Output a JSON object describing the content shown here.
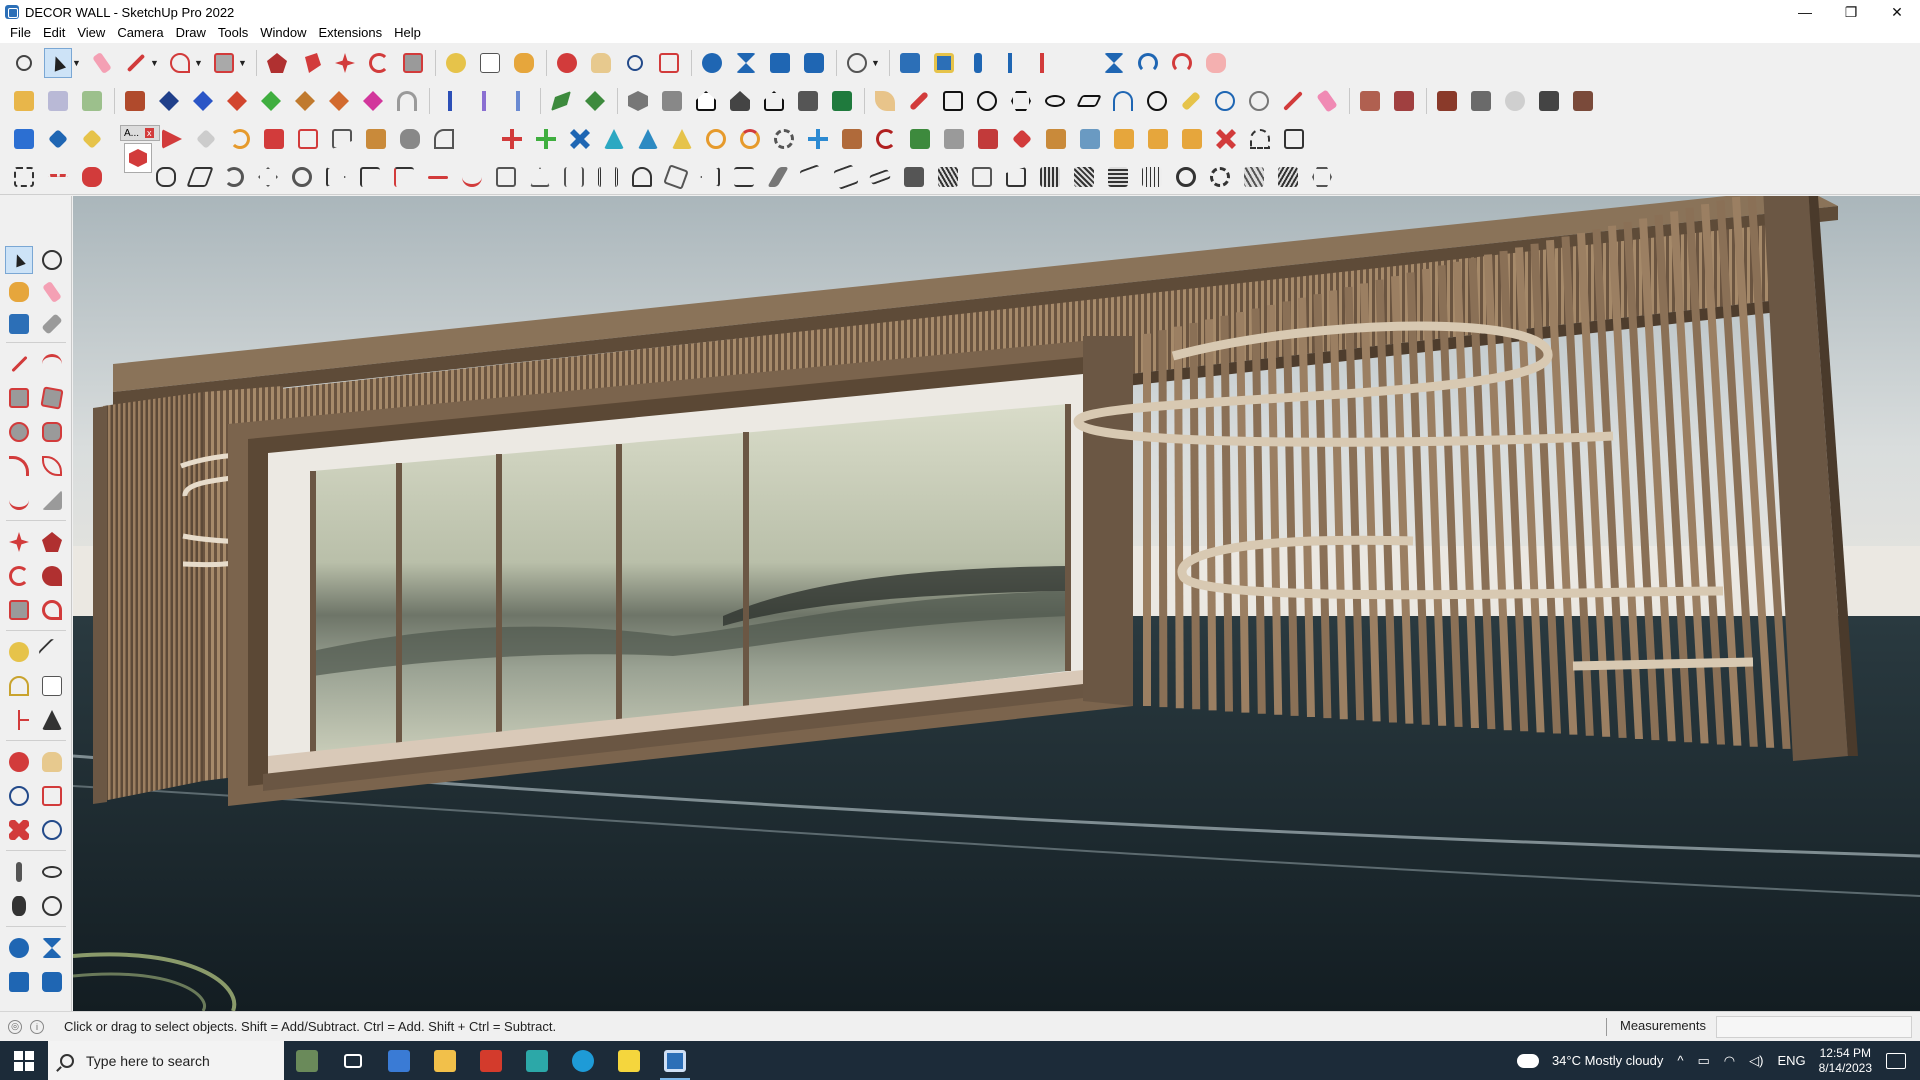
{
  "window": {
    "title": "DECOR WALL - SketchUp Pro 2022",
    "controls": [
      "—",
      "❐",
      "✕"
    ]
  },
  "menu": [
    "File",
    "Edit",
    "View",
    "Camera",
    "Draw",
    "Tools",
    "Window",
    "Extensions",
    "Help"
  ],
  "floating_tab": {
    "label": "A...",
    "close": "x"
  },
  "status": {
    "hint": "Click or drag to select objects. Shift = Add/Subtract. Ctrl = Add. Shift + Ctrl = Subtract.",
    "measurements_label": "Measurements",
    "measurements_value": ""
  },
  "taskbar": {
    "search_placeholder": "Type here to search",
    "weather": "34°C  Mostly cloudy",
    "language": "ENG",
    "time": "12:54 PM",
    "date": "8/14/2023"
  },
  "colors": {
    "sky": "#c8cfd2",
    "wood": "#8a7359",
    "wood_dark": "#5e4b38",
    "ground": "#1c2b30",
    "accent": "#2c6fb7"
  }
}
